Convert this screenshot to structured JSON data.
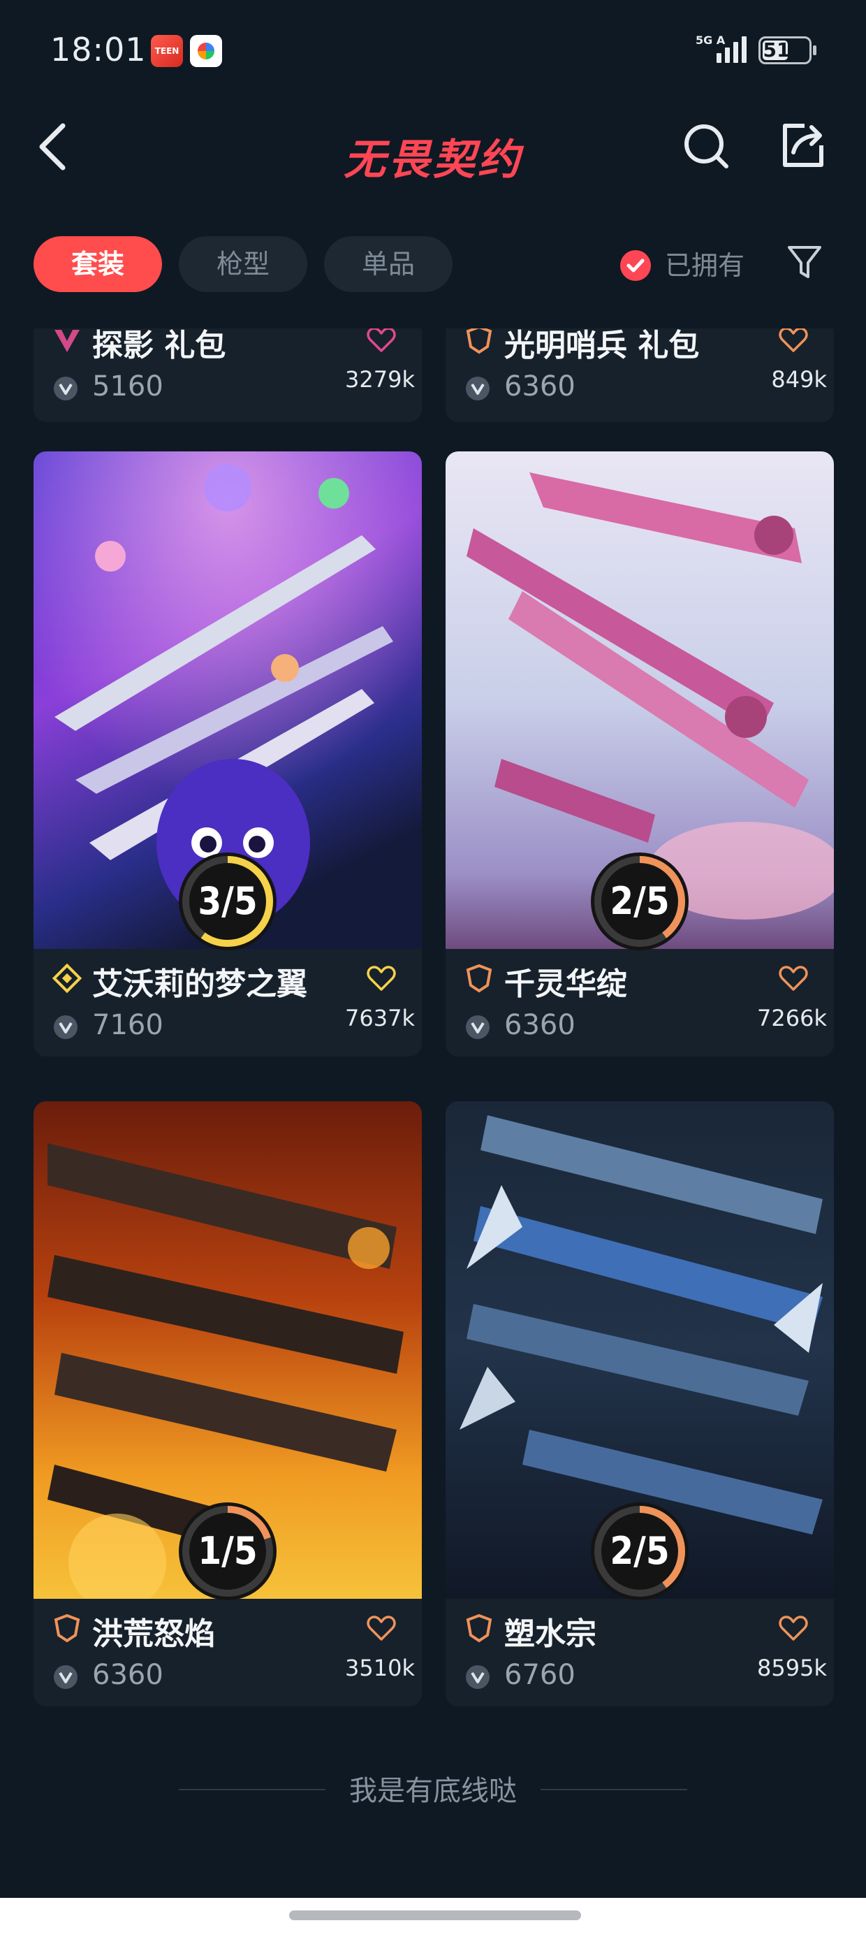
{
  "status_bar": {
    "time": "18:01",
    "app_icon_1": "TEEN",
    "network": "5G A",
    "battery": "51"
  },
  "header": {
    "title": "无畏契约"
  },
  "filters": {
    "tabs": [
      {
        "label": "套装",
        "active": true
      },
      {
        "label": "枪型",
        "active": false
      },
      {
        "label": "单品",
        "active": false
      }
    ],
    "owned_label": "已拥有"
  },
  "cards": [
    {
      "name": "探影 礼包",
      "price": "5160",
      "likes": "3279k",
      "tier_color": "#d24a8a",
      "fav_color": "#e2488f"
    },
    {
      "name": "光明哨兵 礼包",
      "price": "6360",
      "likes": "849k",
      "tier_color": "#f0935a",
      "fav_color": "#f0935a"
    },
    {
      "name": "艾沃莉的梦之翼",
      "price": "7160",
      "likes": "7637k",
      "progress": "3/5",
      "progress_value": 0.6,
      "ring_color": "#f5d24a",
      "tier_color": "#f5d24a",
      "fav_color": "#f5d24a"
    },
    {
      "name": "千灵华绽",
      "price": "6360",
      "likes": "7266k",
      "progress": "2/5",
      "progress_value": 0.4,
      "ring_color": "#f0935a",
      "tier_color": "#f0935a",
      "fav_color": "#f0935a"
    },
    {
      "name": "洪荒怒焰",
      "price": "6360",
      "likes": "3510k",
      "progress": "1/5",
      "progress_value": 0.2,
      "ring_color": "#f0935a",
      "tier_color": "#f0935a",
      "fav_color": "#f0935a"
    },
    {
      "name": "塑水宗",
      "price": "6760",
      "likes": "8595k",
      "progress": "2/5",
      "progress_value": 0.4,
      "ring_color": "#f0935a",
      "tier_color": "#f0935a",
      "fav_color": "#f0935a"
    }
  ],
  "footer": {
    "end_text": "我是有底线哒"
  }
}
